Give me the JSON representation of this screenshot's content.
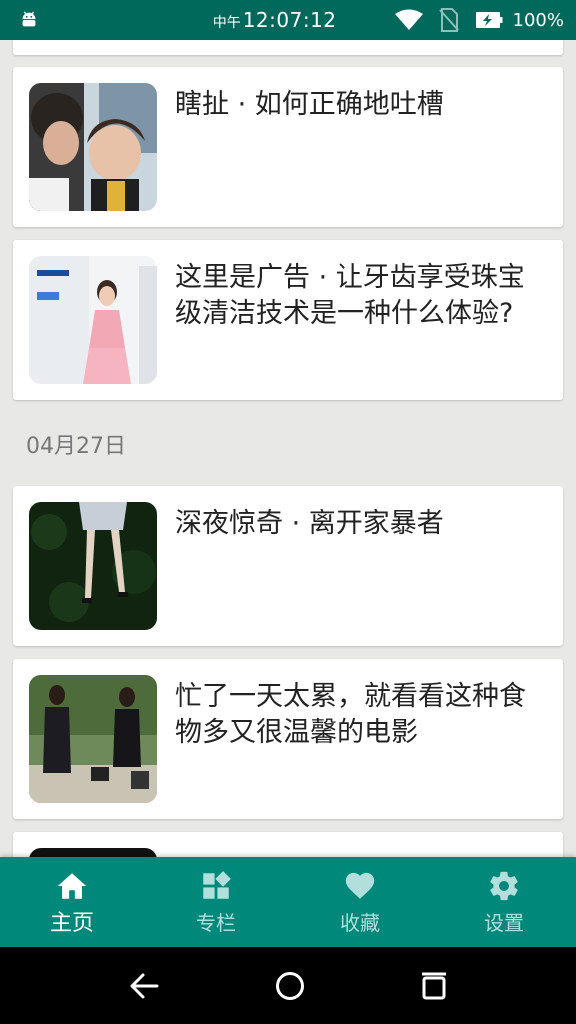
{
  "status_bar": {
    "ampm": "中午",
    "time": "12:07:12",
    "battery": "100%"
  },
  "feed": {
    "items": [
      {
        "title": "瞎扯 · 如何正确地吐槽"
      },
      {
        "title": "这里是广告 · 让牙齿享受珠宝级清洁技术是一种什么体验?"
      },
      {
        "title": "深夜惊奇 · 离开家暴者"
      },
      {
        "title": "忙了一天太累，就看看这种食物多又很温馨的电影"
      }
    ],
    "date_header": "04月27日"
  },
  "bottom_nav": {
    "items": [
      {
        "label": "主页",
        "icon": "home-icon",
        "active": true
      },
      {
        "label": "专栏",
        "icon": "columns-icon",
        "active": false
      },
      {
        "label": "收藏",
        "icon": "heart-icon",
        "active": false
      },
      {
        "label": "设置",
        "icon": "gear-icon",
        "active": false
      }
    ]
  },
  "system_nav": {
    "icons": [
      "back-icon",
      "home-circle-icon",
      "recents-icon"
    ]
  },
  "colors": {
    "status_bar": "#00695c",
    "bottom_nav": "#00897b",
    "background": "#e8e8e6"
  }
}
